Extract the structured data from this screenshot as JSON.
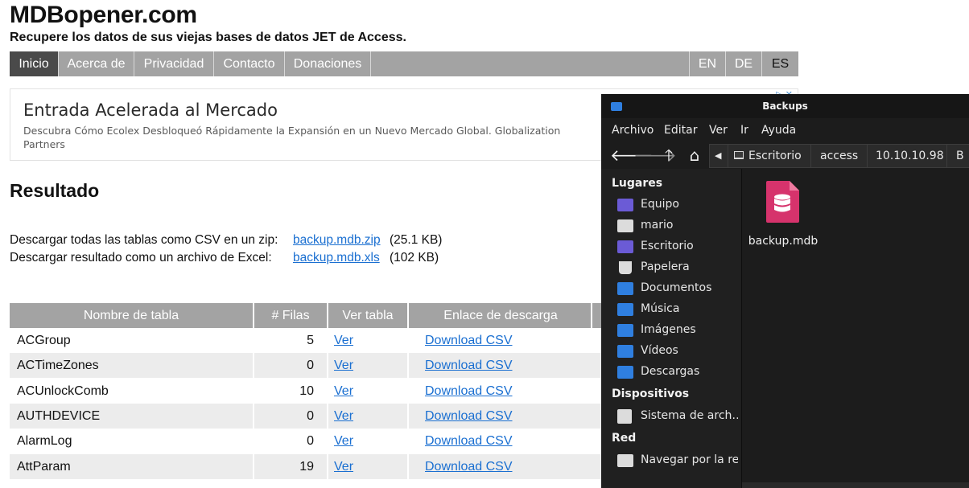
{
  "site": {
    "title": "MDBopener.com",
    "tagline": "Recupere los datos de sus viejas bases de datos JET de Access."
  },
  "nav": {
    "items": [
      {
        "label": "Inicio",
        "active": true
      },
      {
        "label": "Acerca de"
      },
      {
        "label": "Privacidad"
      },
      {
        "label": "Contacto"
      },
      {
        "label": "Donaciones"
      }
    ],
    "languages": [
      "EN",
      "DE",
      "ES"
    ]
  },
  "ad": {
    "title": "Entrada Acelerada al Mercado",
    "description": "Descubra Cómo Ecolex Desbloqueó Rápidamente la Expansión en un Nuevo Mercado Global. Globalization Partners"
  },
  "result": {
    "heading": "Resultado",
    "zip_text": "Descargar todas las tablas como CSV en un zip:",
    "zip_link": "backup.mdb.zip",
    "zip_size": "(25.1 KB)",
    "xls_text": "Descargar resultado como un archivo de Excel:",
    "xls_link": "backup.mdb.xls",
    "xls_size": "(102 KB)"
  },
  "table": {
    "headers": [
      "Nombre de tabla",
      "# Filas",
      "Ver tabla",
      "Enlace de descarga"
    ],
    "rows": [
      {
        "name": "ACGroup",
        "rows": "5",
        "view": "Ver",
        "download": "Download CSV"
      },
      {
        "name": "ACTimeZones",
        "rows": "0",
        "view": "Ver",
        "download": "Download CSV"
      },
      {
        "name": "ACUnlockComb",
        "rows": "10",
        "view": "Ver",
        "download": "Download CSV"
      },
      {
        "name": "AUTHDEVICE",
        "rows": "0",
        "view": "Ver",
        "download": "Download CSV"
      },
      {
        "name": "AlarmLog",
        "rows": "0",
        "view": "Ver",
        "download": "Download CSV"
      },
      {
        "name": "AttParam",
        "rows": "19",
        "view": "Ver",
        "download": "Download CSV"
      }
    ]
  },
  "file_manager": {
    "title": "Backups",
    "menu": [
      "Archivo",
      "Editar",
      "Ver",
      "Ir",
      "Ayuda"
    ],
    "path": [
      "Escritorio",
      "access",
      "10.10.10.98",
      "B"
    ],
    "sections": {
      "places": "Lugares",
      "devices": "Dispositivos",
      "network": "Red"
    },
    "places": [
      {
        "label": "Equipo",
        "icon": "computer-icon",
        "color": "#6b5bd6"
      },
      {
        "label": "mario",
        "icon": "home-folder-icon",
        "color": "#dcdcdc"
      },
      {
        "label": "Escritorio",
        "icon": "desktop-icon",
        "color": "#6b5bd6"
      },
      {
        "label": "Papelera",
        "icon": "trash-icon",
        "color": "#dcdcdc"
      },
      {
        "label": "Documentos",
        "icon": "documents-folder-icon",
        "color": "#2f7fe0"
      },
      {
        "label": "Música",
        "icon": "music-folder-icon",
        "color": "#2f7fe0"
      },
      {
        "label": "Imágenes",
        "icon": "pictures-folder-icon",
        "color": "#2f7fe0"
      },
      {
        "label": "Vídeos",
        "icon": "videos-folder-icon",
        "color": "#2f7fe0"
      },
      {
        "label": "Descargas",
        "icon": "downloads-folder-icon",
        "color": "#2f7fe0"
      }
    ],
    "devices": [
      {
        "label": "Sistema de arch…",
        "icon": "filesystem-icon",
        "color": "#dcdcdc"
      }
    ],
    "network": [
      {
        "label": "Navegar por la red",
        "icon": "network-icon",
        "color": "#dcdcdc"
      }
    ],
    "file": {
      "name": "backup.mdb",
      "icon": "database-file-icon",
      "color": "#d6336c"
    }
  }
}
